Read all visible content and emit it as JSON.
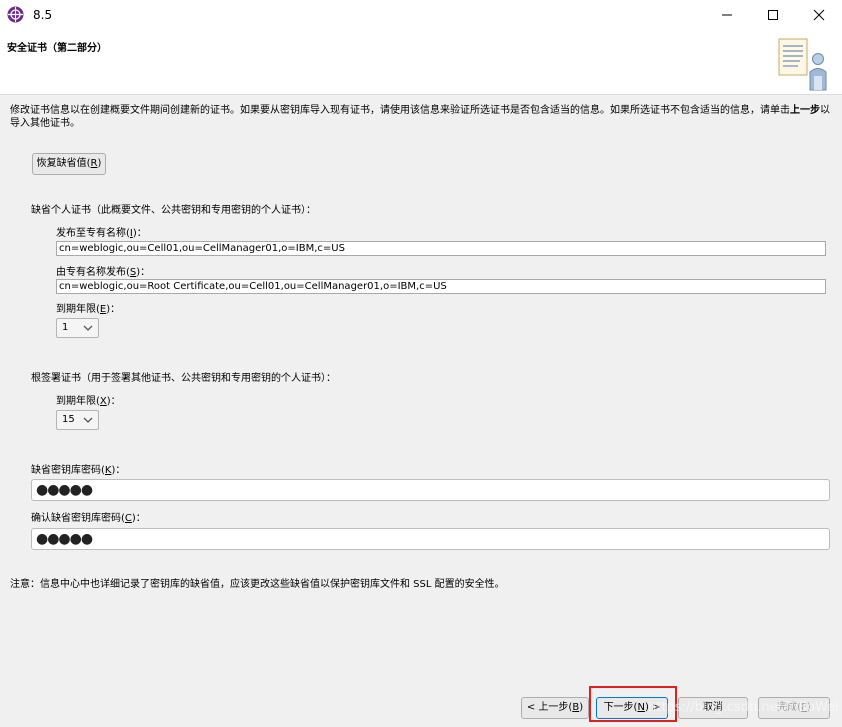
{
  "window": {
    "title": "8.5",
    "controls": {
      "minimize": "minimize-icon",
      "maximize": "maximize-icon",
      "close": "close-icon"
    }
  },
  "header": {
    "title": "安全证书（第二部分）",
    "graphic": "wizard-document-user-icon"
  },
  "description": {
    "text_before": "修改证书信息以在创建概要文件期间创建新的证书。如果要从密钥库导入现有证书，请使用该信息来验证所选证书是否包含适当的信息。如果所选证书不包含适当的信息，请单击",
    "bold": "上一步",
    "text_after": "以导入其他证书。"
  },
  "restore_button": {
    "label": "恢复缺省值(",
    "mnemonic": "R",
    "suffix": ")"
  },
  "personal_cert": {
    "section_label": "缺省个人证书（此概要文件、公共密钥和专用密钥的个人证书）：",
    "issued_to": {
      "label": "发布至专有名称(",
      "mnemonic": "I",
      "suffix": ")：",
      "value": "cn=weblogic,ou=Cell01,ou=CellManager01,o=IBM,c=US"
    },
    "issued_by": {
      "label": "由专有名称发布(",
      "mnemonic": "S",
      "suffix": ")：",
      "value": "cn=weblogic,ou=Root Certificate,ou=Cell01,ou=CellManager01,o=IBM,c=US"
    },
    "expiration": {
      "label": "到期年限(",
      "mnemonic": "E",
      "suffix": ")：",
      "value": "1"
    }
  },
  "root_cert": {
    "section_label": "根签署证书（用于签署其他证书、公共密钥和专用密钥的个人证书）：",
    "expiration": {
      "label": "到期年限(",
      "mnemonic": "X",
      "suffix": ")：",
      "value": "15"
    }
  },
  "keystore_password": {
    "label": "缺省密钥库密码(",
    "mnemonic": "K",
    "suffix": ")：",
    "value": "●●●●●"
  },
  "confirm_password": {
    "label": "确认缺省密钥库密码(",
    "mnemonic": "C",
    "suffix": ")：",
    "value": "●●●●●"
  },
  "note": "注意：信息中心中也详细记录了密钥库的缺省值，应该更改这些缺省值以保护密钥库文件和 SSL 配置的安全性。",
  "footer": {
    "back": {
      "label": "< 上一步(",
      "mnemonic": "B",
      "suffix": ")"
    },
    "next": {
      "label": "下一步(",
      "mnemonic": "N",
      "suffix": ") >"
    },
    "cancel": {
      "label": "取消"
    },
    "finish": {
      "label": "完成(",
      "mnemonic": "F",
      "suffix": ")"
    }
  },
  "watermark": "https://blog.csdn.net/YiBoWei",
  "colors": {
    "highlight": "#e0201f",
    "background": "#f0f0f0",
    "header_bg": "#ffffff",
    "app_icon": "#6a2a8e"
  }
}
